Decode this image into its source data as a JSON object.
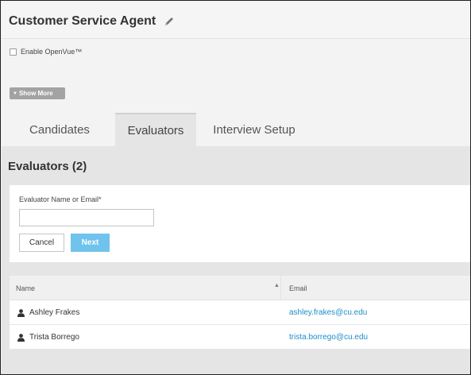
{
  "header": {
    "title": "Customer Service Agent",
    "enable_openvue_label": "Enable OpenVue™",
    "show_more_label": "Show More"
  },
  "tabs": [
    {
      "label": "Candidates",
      "active": false
    },
    {
      "label": "Evaluators",
      "active": true
    },
    {
      "label": "Interview Setup",
      "active": false
    }
  ],
  "evaluators": {
    "section_title": "Evaluators (2)",
    "form": {
      "field_label": "Evaluator Name or Email*",
      "field_value": "",
      "field_placeholder": "",
      "cancel_label": "Cancel",
      "next_label": "Next"
    },
    "table": {
      "columns": [
        "Name",
        "Email"
      ],
      "rows": [
        {
          "name": "Ashley Frakes",
          "email": "ashley.frakes@cu.edu"
        },
        {
          "name": "Trista Borrego",
          "email": "trista.borrego@cu.edu"
        }
      ]
    }
  },
  "colors": {
    "accent": "#6fc3ec",
    "link": "#1d8fc9",
    "button_gray": "#a3a3a3"
  },
  "icons": {
    "title_edit": "pencil-icon",
    "row_person": "user-icon",
    "sort": "sort-asc-icon"
  }
}
